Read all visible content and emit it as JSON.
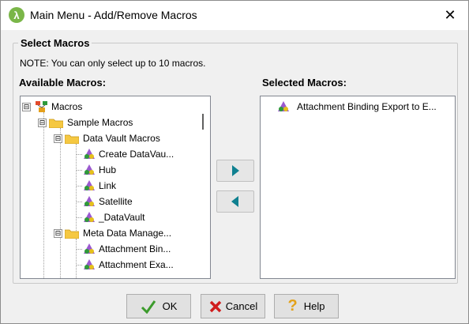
{
  "window": {
    "title": "Main Menu - Add/Remove Macros",
    "close_glyph": "✕",
    "app_icon_glyph": "λ"
  },
  "group": {
    "title": "Select Macros",
    "note": "NOTE: You can only select up to 10 macros."
  },
  "available": {
    "label": "Available Macros:",
    "tree": [
      {
        "label": "Macros",
        "icon": "macro-root-icon",
        "expander": "⊟"
      },
      {
        "label": "Sample Macros",
        "icon": "folder-icon",
        "expander": "⊟"
      },
      {
        "label": "Data Vault Macros",
        "icon": "folder-icon",
        "expander": "⊟"
      },
      {
        "label": "Create DataVau...",
        "icon": "macro-icon"
      },
      {
        "label": "Hub",
        "icon": "macro-icon"
      },
      {
        "label": "Link",
        "icon": "macro-icon"
      },
      {
        "label": "Satellite",
        "icon": "macro-icon"
      },
      {
        "label": "_DataVault",
        "icon": "macro-icon"
      },
      {
        "label": "Meta Data Manage...",
        "icon": "folder-icon",
        "expander": "⊟"
      },
      {
        "label": "Attachment Bin...",
        "icon": "macro-icon"
      },
      {
        "label": "Attachment Exa...",
        "icon": "macro-icon"
      }
    ]
  },
  "selected": {
    "label": "Selected Macros:",
    "items": [
      {
        "label": "Attachment Binding Export to E...",
        "icon": "macro-icon"
      }
    ]
  },
  "arrows": {
    "add_icon": "arrow-right-icon",
    "remove_icon": "arrow-left-icon",
    "color": "#0f8090"
  },
  "buttons": {
    "ok": "OK",
    "cancel": "Cancel",
    "help": "Help",
    "help_glyph": "?"
  },
  "colors": {
    "folder": "#f5c842",
    "ok_check": "#3c9b2c",
    "cancel_x": "#d01c1c",
    "help_q": "#e3a21a"
  }
}
